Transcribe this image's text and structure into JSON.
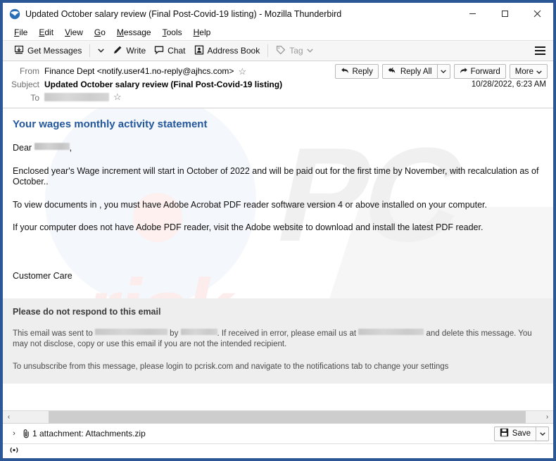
{
  "window": {
    "title": "Updated October salary review (Final Post-Covid-19 listing) - Mozilla Thunderbird",
    "app_icon": "thunderbird-icon",
    "frame_color": "#2b5797",
    "controls": {
      "minimize": "minimize-icon",
      "maximize": "maximize-icon",
      "close": "close-icon"
    }
  },
  "menubar": {
    "items": [
      {
        "label": "File",
        "accel": "F"
      },
      {
        "label": "Edit",
        "accel": "E"
      },
      {
        "label": "View",
        "accel": "V"
      },
      {
        "label": "Go",
        "accel": "G"
      },
      {
        "label": "Message",
        "accel": "M"
      },
      {
        "label": "Tools",
        "accel": "T"
      },
      {
        "label": "Help",
        "accel": "H"
      }
    ]
  },
  "toolbar": {
    "get_messages": "Get Messages",
    "get_messages_caret": "⌄",
    "write": "Write",
    "chat": "Chat",
    "address_book": "Address Book",
    "tag": "Tag",
    "tag_caret": "⌄",
    "tag_disabled": true,
    "app_menu": "app-menu-icon"
  },
  "message_header": {
    "from_label": "From",
    "from_value": "Finance Dept <notify.user41.no-reply@ajhcs.com>",
    "subject_label": "Subject",
    "subject_value": "Updated October salary review (Final Post-Covid-19 listing)",
    "to_label": "To",
    "to_value_redacted": true,
    "star": "☆",
    "date": "10/28/2022, 6:23 AM",
    "actions": {
      "reply": "Reply",
      "reply_all": "Reply All",
      "forward": "Forward",
      "more": "More",
      "caret": "⌄"
    }
  },
  "body": {
    "heading": "Your wages monthly activity statement",
    "heading_color": "#24579c",
    "greeting_prefix": "Dear",
    "greeting_redacted": true,
    "greeting_suffix": ",",
    "paragraph_1": "Enclosed year's Wage increment will start in October of 2022 and will be paid out for the first time by November, with recalculation as of October..",
    "paragraph_2": "To view documents in , you must have Adobe Acrobat PDF reader software version 4 or above installed on your computer.",
    "paragraph_3": "If your computer does not have Adobe PDF reader, visit the Adobe website to download and install the latest PDF reader.",
    "signature": "Customer Care",
    "watermark_text_1": "PC",
    "watermark_text_2": "risk"
  },
  "footer": {
    "heading": "Please do not respond to this email",
    "disclaimer_part_1": "This email was sent to",
    "disclaimer_part_2": "by",
    "disclaimer_part_3": ". If received in error, please email us at",
    "disclaimer_part_4": "and delete this message. You may not disclose, copy or use this email if you are not the intended recipient.",
    "unsubscribe": "To unsubscribe from this message, please login to pcrisk.com and navigate to the notifications tab to change your settings",
    "background": "#eeeeee"
  },
  "scrollbar": {
    "left_arrow": "‹",
    "right_arrow": "›"
  },
  "attachments": {
    "expand_chevron": "›",
    "clip_icon": "paperclip-icon",
    "summary": "1 attachment: Attachments.zip",
    "save_label": "Save",
    "save_caret": "⌄"
  },
  "statusbar": {
    "icon": "connection-icon"
  }
}
